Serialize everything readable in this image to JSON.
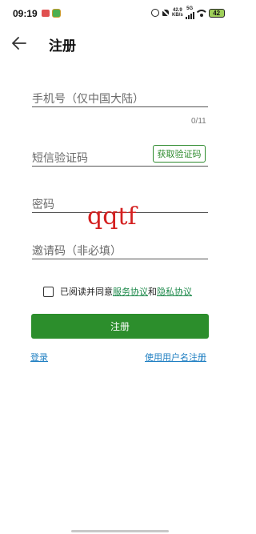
{
  "status_bar": {
    "time": "09:19",
    "net_speed_value": "42.9",
    "net_speed_unit": "KB/s",
    "network_type": "5G",
    "battery": "42"
  },
  "header": {
    "title": "注册"
  },
  "form": {
    "phone_placeholder": "手机号（仅中国大陆）",
    "phone_value": "",
    "phone_counter": "0/11",
    "sms_code_placeholder": "短信验证码",
    "sms_code_value": "",
    "get_code_label": "获取验证码",
    "password_placeholder": "密码",
    "password_value": "",
    "invite_code_placeholder": "邀请码（非必填）",
    "invite_code_value": ""
  },
  "overlay_text": "qqtf",
  "agreement": {
    "checked": false,
    "prefix": "已阅读并同意",
    "service_link": "服务协议",
    "and": "和",
    "privacy_link": "隐私协议"
  },
  "actions": {
    "register_label": "注册",
    "login_link": "登录",
    "username_register_link": "使用用户名注册"
  },
  "colors": {
    "primary_green": "#2c8e2c",
    "link_blue": "#1f7fc2",
    "link_green": "#1f8a4c",
    "overlay_red": "#d42020"
  },
  "icons": {
    "back": "back-arrow-icon",
    "checkbox": "checkbox-icon"
  }
}
